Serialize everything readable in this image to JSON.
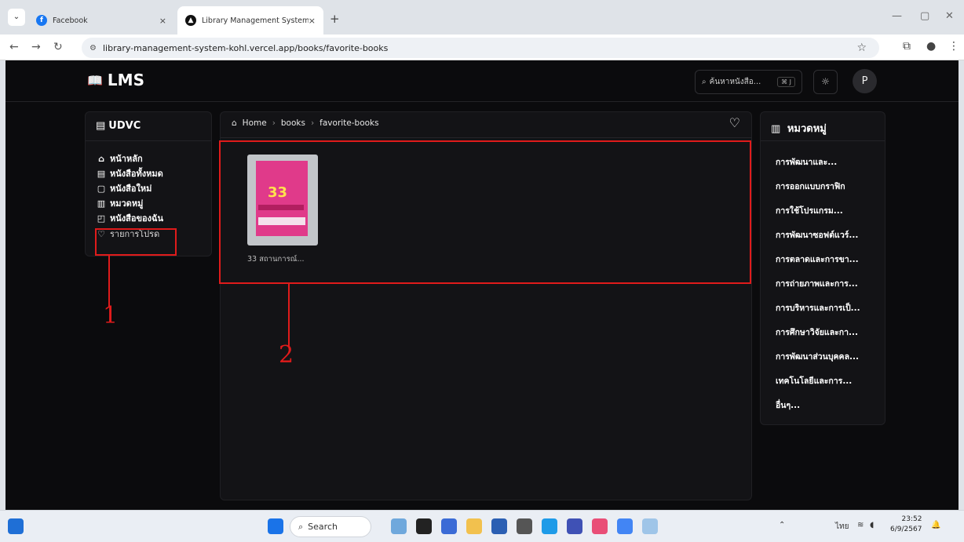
{
  "browser": {
    "tabs": [
      {
        "title": "Facebook",
        "close": "×"
      },
      {
        "title": "Library Management System",
        "close": "×"
      }
    ],
    "new_tab": "+",
    "url": "library-management-system-kohl.vercel.app/books/favorite-books"
  },
  "header": {
    "logo_text": "LMS",
    "search_placeholder": "ค้นหาหนังสือ...",
    "search_shortcut": "⌘ J",
    "avatar_letter": "P"
  },
  "sidebar": {
    "title": "UDVC",
    "items": [
      {
        "label": "หน้าหลัก",
        "icon": "⌂"
      },
      {
        "label": "หนังสือทั้งหมด",
        "icon": "▤"
      },
      {
        "label": "หนังสือใหม่",
        "icon": "▢"
      },
      {
        "label": "หมวดหมู่",
        "icon": "▥"
      },
      {
        "label": "หนังสือของฉัน",
        "icon": "◰"
      },
      {
        "label": "รายการโปรด",
        "icon": "♡"
      }
    ]
  },
  "breadcrumb": {
    "home": "Home",
    "sep": "›",
    "items": [
      "books",
      "favorite-books"
    ]
  },
  "books": [
    {
      "title": "33 สถานการณ์..."
    }
  ],
  "categories": {
    "title": "หมวดหมู่",
    "items": [
      "การพัฒนาและ...",
      "การออกแบบกราฟิก",
      "การใช้โปรแกรม...",
      "การพัฒนาซอฟต์แวร์...",
      "การตลาดและการขา...",
      "การถ่ายภาพและการ...",
      "การบริหารและการเป็...",
      "การศึกษาวิจัยและกา...",
      "การพัฒนาส่วนบุคคล...",
      "เทคโนโลยีและการ...",
      "อื่นๆ..."
    ]
  },
  "annotations": {
    "one": "1",
    "two": "2"
  },
  "taskbar": {
    "search_label": "Search",
    "lang": "ไทย",
    "time": "23:52",
    "date": "6/9/2567"
  },
  "colors": {
    "accent_red": "#e01b1b",
    "page_bg": "#0b0b0d",
    "panel_bg": "#131316"
  }
}
